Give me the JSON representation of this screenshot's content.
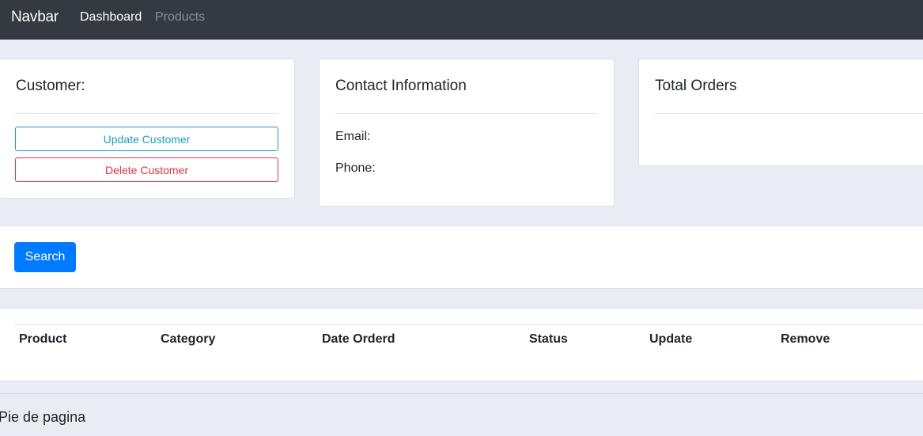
{
  "navbar": {
    "brand": "Navbar",
    "links": [
      {
        "label": "Dashboard",
        "active": true
      },
      {
        "label": "Products",
        "active": false
      }
    ]
  },
  "customer_card": {
    "title": "Customer:",
    "update_label": "Update Customer",
    "delete_label": "Delete Customer"
  },
  "contact_card": {
    "title": "Contact Information",
    "email_label": "Email:",
    "phone_label": "Phone:"
  },
  "orders_card": {
    "title": "Total Orders"
  },
  "search": {
    "button_label": "Search"
  },
  "orders_table": {
    "headers": [
      "Product",
      "Category",
      "Date Orderd",
      "Status",
      "Update",
      "Remove"
    ]
  },
  "footer": {
    "text": "Pie de pagina"
  },
  "colors": {
    "navbar_bg": "#343a40",
    "primary": "#007bff",
    "info": "#17a2b8",
    "danger": "#dc3545",
    "page_bg": "#e9ecf2"
  }
}
